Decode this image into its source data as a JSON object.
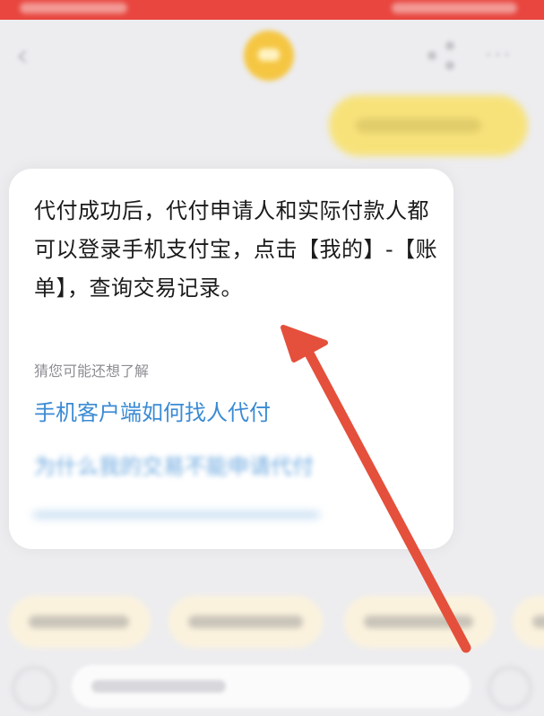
{
  "chat": {
    "answer": "代付成功后，代付申请人和实际付款人都可以登录手机支付宝，点击【我的】-【账单】，查询交易记录。",
    "related_label": "猜您可能还想了解",
    "related_links": [
      {
        "label": "手机客户端如何找人代付"
      },
      {
        "label": "为什么我的交易不能申请代付"
      }
    ]
  },
  "icons": {
    "back": "chevron-left-icon",
    "share": "share-icon",
    "more": "more-icon"
  },
  "colors": {
    "status_bar": "#e8463f",
    "link": "#3b8bd4",
    "annotation_arrow": "#e4503c",
    "user_bubble": "#f7e27a"
  }
}
